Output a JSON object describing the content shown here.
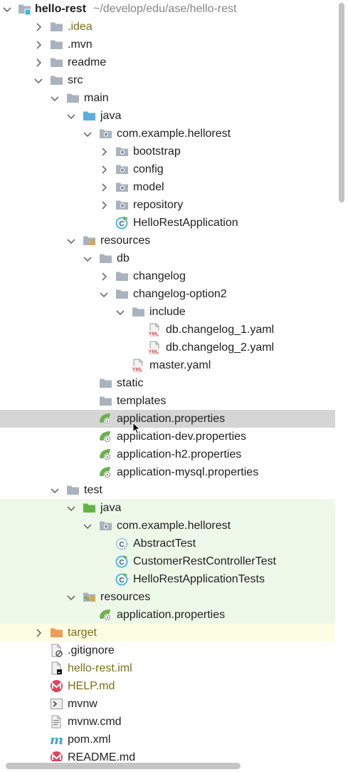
{
  "project": {
    "name": "hello-rest",
    "path": "~/develop/edu/ase/hello-rest"
  },
  "tree": [
    {
      "depth": 0,
      "chevron": "down",
      "icon": "module-folder-icon",
      "label": "hello-rest",
      "style": "bold",
      "path": "~/develop/edu/ase/hello-rest"
    },
    {
      "depth": 1,
      "chevron": "right",
      "icon": "folder-icon",
      "label": ".idea",
      "style": "olive"
    },
    {
      "depth": 1,
      "chevron": "right",
      "icon": "folder-icon",
      "label": ".mvn"
    },
    {
      "depth": 1,
      "chevron": "right",
      "icon": "folder-icon",
      "label": "readme"
    },
    {
      "depth": 1,
      "chevron": "down",
      "icon": "folder-icon",
      "label": "src"
    },
    {
      "depth": 2,
      "chevron": "down",
      "icon": "folder-icon",
      "label": "main"
    },
    {
      "depth": 3,
      "chevron": "down",
      "icon": "source-folder-icon",
      "label": "java"
    },
    {
      "depth": 4,
      "chevron": "down",
      "icon": "package-icon",
      "label": "com.example.hellorest"
    },
    {
      "depth": 5,
      "chevron": "right",
      "icon": "package-icon",
      "label": "bootstrap"
    },
    {
      "depth": 5,
      "chevron": "right",
      "icon": "package-icon",
      "label": "config"
    },
    {
      "depth": 5,
      "chevron": "right",
      "icon": "package-icon",
      "label": "model"
    },
    {
      "depth": 5,
      "chevron": "right",
      "icon": "package-icon",
      "label": "repository"
    },
    {
      "depth": 5,
      "chevron": "none",
      "icon": "spring-boot-class-icon",
      "label": "HelloRestApplication"
    },
    {
      "depth": 3,
      "chevron": "down",
      "icon": "resources-folder-icon",
      "label": "resources"
    },
    {
      "depth": 4,
      "chevron": "down",
      "icon": "folder-icon",
      "label": "db"
    },
    {
      "depth": 5,
      "chevron": "right",
      "icon": "folder-icon",
      "label": "changelog"
    },
    {
      "depth": 5,
      "chevron": "down",
      "icon": "folder-icon",
      "label": "changelog-option2"
    },
    {
      "depth": 6,
      "chevron": "down",
      "icon": "folder-icon",
      "label": "include"
    },
    {
      "depth": 7,
      "chevron": "none",
      "icon": "yaml-file-icon",
      "label": "db.changelog_1.yaml"
    },
    {
      "depth": 7,
      "chevron": "none",
      "icon": "yaml-file-icon",
      "label": "db.changelog_2.yaml"
    },
    {
      "depth": 6,
      "chevron": "none",
      "icon": "yaml-file-icon",
      "label": "master.yaml"
    },
    {
      "depth": 4,
      "chevron": "none",
      "icon": "folder-icon",
      "label": "static"
    },
    {
      "depth": 4,
      "chevron": "none",
      "icon": "folder-icon",
      "label": "templates"
    },
    {
      "depth": 4,
      "chevron": "none",
      "icon": "spring-properties-icon",
      "label": "application.properties",
      "selected": true
    },
    {
      "depth": 4,
      "chevron": "none",
      "icon": "spring-properties-icon",
      "label": "application-dev.properties"
    },
    {
      "depth": 4,
      "chevron": "none",
      "icon": "spring-properties-icon",
      "label": "application-h2.properties"
    },
    {
      "depth": 4,
      "chevron": "none",
      "icon": "spring-properties-icon",
      "label": "application-mysql.properties"
    },
    {
      "depth": 2,
      "chevron": "down",
      "icon": "folder-icon",
      "label": "test"
    },
    {
      "depth": 3,
      "chevron": "down",
      "icon": "test-source-folder-icon",
      "label": "java",
      "bg": "test"
    },
    {
      "depth": 4,
      "chevron": "down",
      "icon": "package-icon",
      "label": "com.example.hellorest",
      "bg": "test"
    },
    {
      "depth": 5,
      "chevron": "none",
      "icon": "abstract-class-icon",
      "label": "AbstractTest",
      "bg": "test"
    },
    {
      "depth": 5,
      "chevron": "none",
      "icon": "test-class-icon",
      "label": "CustomerRestControllerTest",
      "bg": "test"
    },
    {
      "depth": 5,
      "chevron": "none",
      "icon": "test-class-icon",
      "label": "HelloRestApplicationTests",
      "bg": "test"
    },
    {
      "depth": 3,
      "chevron": "down",
      "icon": "test-resources-folder-icon",
      "label": "resources",
      "bg": "test"
    },
    {
      "depth": 4,
      "chevron": "none",
      "icon": "spring-properties-icon",
      "label": "application.properties",
      "bg": "test"
    },
    {
      "depth": 1,
      "chevron": "right",
      "icon": "excluded-folder-icon",
      "label": "target",
      "style": "olive",
      "bg": "excluded"
    },
    {
      "depth": 1,
      "chevron": "none",
      "icon": "gitignore-file-icon",
      "label": ".gitignore"
    },
    {
      "depth": 1,
      "chevron": "none",
      "icon": "iml-file-icon",
      "label": "hello-rest.iml",
      "style": "olive"
    },
    {
      "depth": 1,
      "chevron": "none",
      "icon": "markdown-file-icon",
      "label": "HELP.md",
      "style": "olive"
    },
    {
      "depth": 1,
      "chevron": "none",
      "icon": "shell-script-icon",
      "label": "mvnw"
    },
    {
      "depth": 1,
      "chevron": "none",
      "icon": "text-file-icon",
      "label": "mvnw.cmd"
    },
    {
      "depth": 1,
      "chevron": "none",
      "icon": "maven-pom-icon",
      "label": "pom.xml"
    },
    {
      "depth": 1,
      "chevron": "none",
      "icon": "markdown-file-icon",
      "label": "README.md"
    }
  ],
  "colors": {
    "folder": "#a9b3bd",
    "source_folder": "#5aaee2",
    "test_folder": "#62b543",
    "excluded_folder": "#ef9a55",
    "package_dot": "#7f8b98",
    "spring_green": "#6cb052",
    "class_cyan": "#40b6e0",
    "yaml_red": "#d7484c",
    "markdown_red": "#d9475e",
    "maven_blue": "#3aa8d8",
    "olive_text": "#7c6f14",
    "selection_bg": "#d5d5d5",
    "test_bg": "#eef8e9",
    "excluded_bg": "#fdfde3",
    "path_text": "#858585"
  }
}
